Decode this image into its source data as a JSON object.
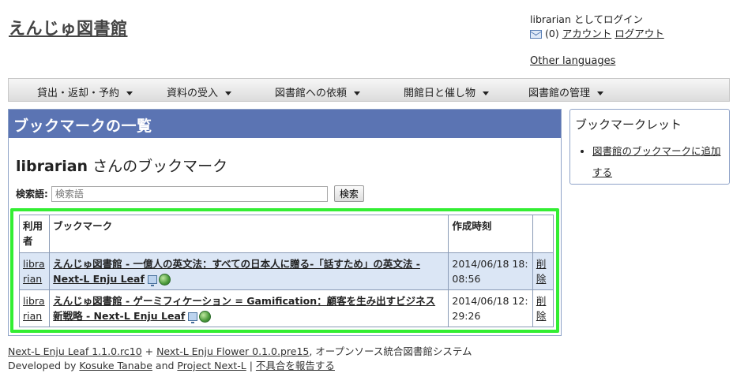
{
  "site": {
    "title": "えんじゅ図書館"
  },
  "user_box": {
    "login_text": "librarian としてログイン",
    "message_count": "(0)",
    "account_link": "アカウント",
    "logout_link": "ログアウト",
    "other_languages": "Other languages"
  },
  "menu": {
    "items": [
      {
        "label": "貸出・返却・予約"
      },
      {
        "label": "資料の受入"
      },
      {
        "label": "図書館への依頼"
      },
      {
        "label": "開館日と催し物"
      },
      {
        "label": "図書館の管理"
      }
    ]
  },
  "main": {
    "panel_title": "ブックマークの一覧",
    "heading_user": "librarian",
    "heading_suffix": " さんのブックマーク",
    "search": {
      "label": "検索語:",
      "placeholder": "検索語",
      "button": "検索"
    },
    "table": {
      "headers": {
        "user": "利用者",
        "bookmark": "ブックマーク",
        "created": "作成時刻",
        "action": ""
      },
      "rows": [
        {
          "user": "librarian",
          "title": "えんじゅ図書館 - 一億人の英文法：すべての日本人に贈る-「話すため」の英文法 - Next-L Enju Leaf",
          "created": "2014/06/18 18:08:56",
          "action": "削除"
        },
        {
          "user": "librarian",
          "title": "えんじゅ図書館 - ゲーミフィケーション = Gamification：顧客を生み出すビジネス新戦略 - Next-L Enju Leaf",
          "created": "2014/06/18 12:29:26",
          "action": "削除"
        }
      ]
    }
  },
  "sidebar": {
    "title": "ブックマークレット",
    "link": "図書館のブックマークに追加する"
  },
  "footer": {
    "leaf": "Next-L Enju Leaf 1.1.0.rc10",
    "plus": " + ",
    "flower": "Next-L Enju Flower 0.1.0.pre15",
    "suffix": ", オープンソース統合図書館システム",
    "developed_by": "Developed by ",
    "author": "Kosuke Tanabe",
    "and": " and ",
    "project": "Project Next-L",
    "separator": " | ",
    "report": "不具合を報告する"
  },
  "colors": {
    "panel_header": "#5b74b3",
    "highlight": "#33ee33",
    "row_odd": "#dbe6f5"
  }
}
